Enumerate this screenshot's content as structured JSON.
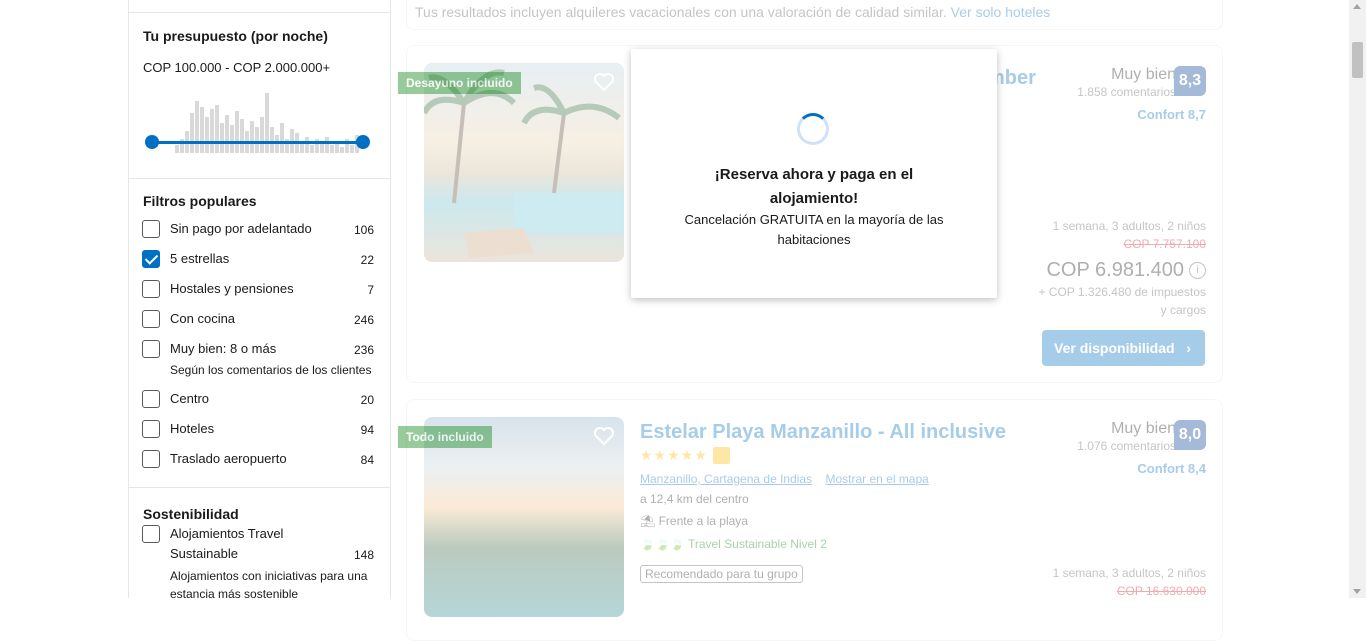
{
  "sidebar": {
    "budget": {
      "title": "Tu presupuesto (por noche)",
      "range": "COP 100.000 - COP 2.000.000+"
    },
    "popular": {
      "title": "Filtros populares",
      "items": [
        {
          "label": "Sin pago por adelantado",
          "count": "106",
          "checked": false
        },
        {
          "label": "5 estrellas",
          "count": "22",
          "checked": true
        },
        {
          "label": "Hostales y pensiones",
          "count": "7",
          "checked": false
        },
        {
          "label": "Con cocina",
          "count": "246",
          "checked": false
        },
        {
          "label": "Muy bien: 8 o más",
          "count": "236",
          "checked": false,
          "sub": "Según los comentarios de los clientes"
        },
        {
          "label": "Centro",
          "count": "20",
          "checked": false
        },
        {
          "label": "Hoteles",
          "count": "94",
          "checked": false
        },
        {
          "label": "Traslado aeropuerto",
          "count": "84",
          "checked": false
        }
      ]
    },
    "sustain": {
      "title": "Sostenibilidad",
      "item": {
        "label_line1": "Alojamientos Travel",
        "label_line2": "Sustainable",
        "count": "148",
        "sub_line1": "Alojamientos con iniciativas para una",
        "sub_line2": "estancia más sostenible"
      }
    }
  },
  "notice": {
    "text": "Tus resultados incluyen alquileres vacacionales con una valoración de calidad similar.",
    "link": "Ver solo hoteles"
  },
  "cards": [
    {
      "ribbon": "Desayuno incluido",
      "name_fragment": "mber",
      "review_word": "Muy bien",
      "review_count": "1.858 comentarios",
      "score": "8,3",
      "comfort": "Confort 8,7",
      "stay": "1 semana, 3 adultos, 2 niños",
      "old_price": "COP 7.757.100",
      "price": "COP 6.981.400",
      "taxes_line1": "+ COP 1.326.480 de impuestos",
      "taxes_line2": "y cargos",
      "button": "Ver disponibilidad"
    },
    {
      "ribbon": "Todo incluido",
      "name": "Estelar Playa Manzanillo - All inclusive",
      "location": "Manzanillo, Cartagena de Indias",
      "map_link": "Mostrar en el mapa",
      "distance": "a 12,4 km del centro",
      "beach": "Frente a la playa",
      "sustainable": "Travel Sustainable Nivel 2",
      "recommended": "Recomendado para tu grupo",
      "review_word": "Muy bien",
      "review_count": "1.076 comentarios",
      "score": "8,0",
      "comfort": "Confort 8,4",
      "stay": "1 semana, 3 adultos, 2 niños",
      "old_price": "COP 16.630.000"
    }
  ],
  "modal": {
    "title": "¡Reserva ahora y paga en el alojamiento!",
    "text": "Cancelación GRATUITA en la mayoría de las habitaciones"
  },
  "colors": {
    "accent": "#0071c2",
    "score_bg": "#003b95",
    "ribbon": "#008009",
    "strike": "#d4111e"
  }
}
